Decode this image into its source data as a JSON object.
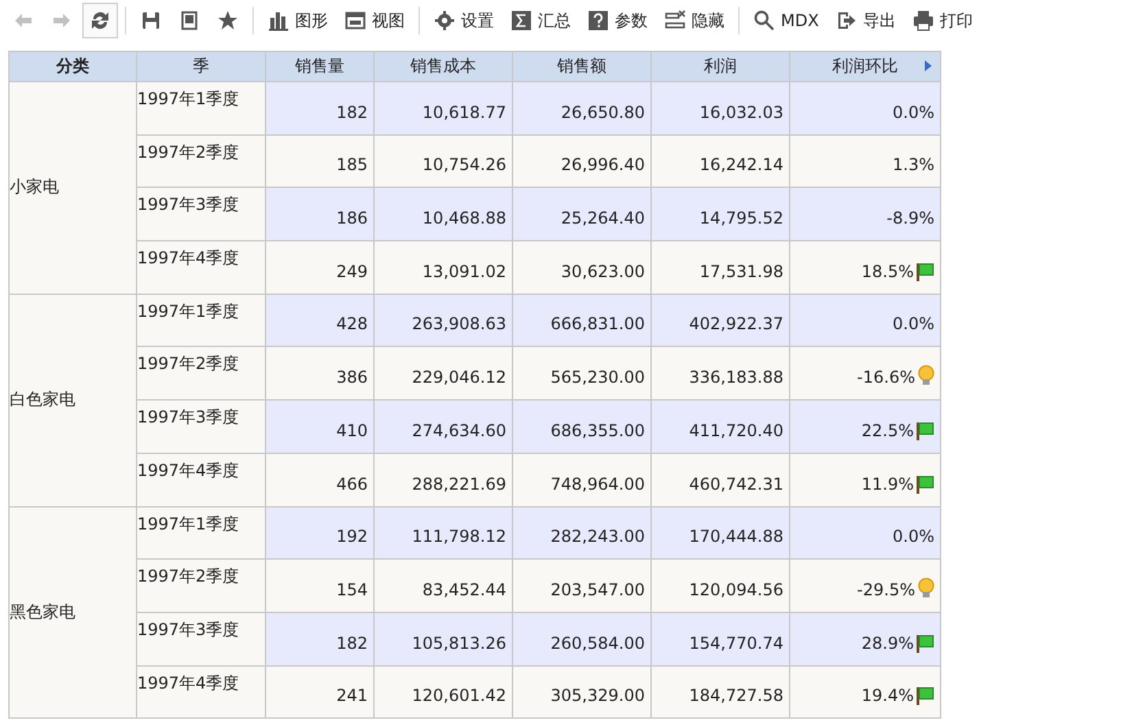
{
  "toolbar": [
    {
      "kind": "back",
      "disabled": true,
      "pressed": false
    },
    {
      "kind": "forward",
      "disabled": true,
      "pressed": false
    },
    {
      "kind": "refresh",
      "disabled": false,
      "pressed": true
    },
    {
      "kind": "separator"
    },
    {
      "kind": "save",
      "disabled": false,
      "pressed": false
    },
    {
      "kind": "save-as",
      "disabled": false,
      "pressed": false
    },
    {
      "kind": "favorite",
      "disabled": false,
      "pressed": false
    },
    {
      "kind": "separator"
    },
    {
      "kind": "chart",
      "label": "图形",
      "disabled": false,
      "pressed": false
    },
    {
      "kind": "view",
      "label": "视图",
      "disabled": false,
      "pressed": false
    },
    {
      "kind": "separator"
    },
    {
      "kind": "settings",
      "label": "设置",
      "disabled": false,
      "pressed": false
    },
    {
      "kind": "sum",
      "label": "汇总",
      "disabled": false,
      "pressed": false
    },
    {
      "kind": "help",
      "label": "参数",
      "disabled": false,
      "pressed": false
    },
    {
      "kind": "hide",
      "label": "隐藏",
      "disabled": false,
      "pressed": false
    },
    {
      "kind": "separator"
    },
    {
      "kind": "search",
      "label": "MDX",
      "disabled": false,
      "pressed": false
    },
    {
      "kind": "export",
      "label": "导出",
      "disabled": false,
      "pressed": false
    },
    {
      "kind": "print",
      "label": "打印",
      "disabled": false,
      "pressed": false
    }
  ],
  "table": {
    "columns": [
      "分类",
      "季",
      "销售量",
      "销售成本",
      "销售额",
      "利润",
      "利润环比"
    ],
    "groups": [
      {
        "category": "小家电",
        "rows": [
          {
            "quarter": "1997年1季度",
            "values": [
              "182",
              "10,618.77",
              "26,650.80",
              "16,032.03",
              "0.0%"
            ],
            "flag": false,
            "bulb": false
          },
          {
            "quarter": "1997年2季度",
            "values": [
              "185",
              "10,754.26",
              "26,996.40",
              "16,242.14",
              "1.3%"
            ],
            "flag": false,
            "bulb": false
          },
          {
            "quarter": "1997年3季度",
            "values": [
              "186",
              "10,468.88",
              "25,264.40",
              "14,795.52",
              "-8.9%"
            ],
            "flag": false,
            "bulb": false
          },
          {
            "quarter": "1997年4季度",
            "values": [
              "249",
              "13,091.02",
              "30,623.00",
              "17,531.98",
              "18.5%"
            ],
            "flag": true,
            "bulb": false
          }
        ]
      },
      {
        "category": "白色家电",
        "rows": [
          {
            "quarter": "1997年1季度",
            "values": [
              "428",
              "263,908.63",
              "666,831.00",
              "402,922.37",
              "0.0%"
            ],
            "flag": false,
            "bulb": false
          },
          {
            "quarter": "1997年2季度",
            "values": [
              "386",
              "229,046.12",
              "565,230.00",
              "336,183.88",
              "-16.6%"
            ],
            "flag": false,
            "bulb": true
          },
          {
            "quarter": "1997年3季度",
            "values": [
              "410",
              "274,634.60",
              "686,355.00",
              "411,720.40",
              "22.5%"
            ],
            "flag": true,
            "bulb": false
          },
          {
            "quarter": "1997年4季度",
            "values": [
              "466",
              "288,221.69",
              "748,964.00",
              "460,742.31",
              "11.9%"
            ],
            "flag": true,
            "bulb": false
          }
        ]
      },
      {
        "category": "黑色家电",
        "rows": [
          {
            "quarter": "1997年1季度",
            "values": [
              "192",
              "111,798.12",
              "282,243.00",
              "170,444.88",
              "0.0%"
            ],
            "flag": false,
            "bulb": false
          },
          {
            "quarter": "1997年2季度",
            "values": [
              "154",
              "83,452.44",
              "203,547.00",
              "120,094.56",
              "-29.5%"
            ],
            "flag": false,
            "bulb": true
          },
          {
            "quarter": "1997年3季度",
            "values": [
              "182",
              "105,813.26",
              "260,584.00",
              "154,770.74",
              "28.9%"
            ],
            "flag": true,
            "bulb": false
          },
          {
            "quarter": "1997年4季度",
            "values": [
              "241",
              "120,601.42",
              "305,329.00",
              "184,727.58",
              "19.4%"
            ],
            "flag": true,
            "bulb": false
          }
        ]
      }
    ]
  }
}
